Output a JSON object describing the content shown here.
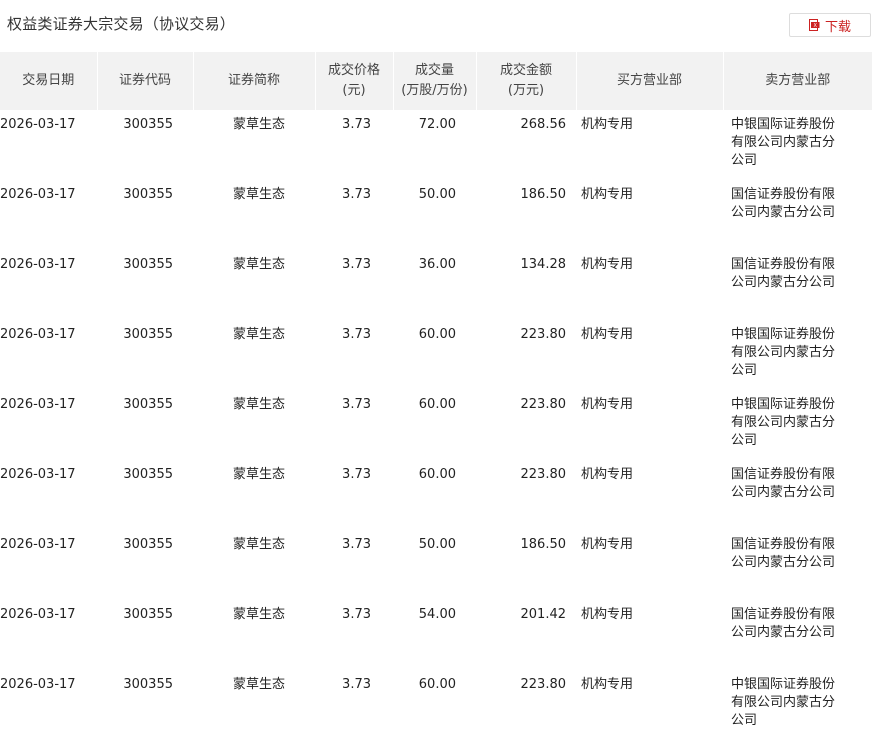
{
  "header": {
    "title": "权益类证券大宗交易（协议交易）",
    "download_label": "下载",
    "download_icon": "download-icon"
  },
  "colors": {
    "accent": "#cc2222",
    "header_bg": "#f2f2f2"
  },
  "table": {
    "columns": [
      [
        "交易日期"
      ],
      [
        "证券代码"
      ],
      [
        "证券简称"
      ],
      [
        "成交价格",
        "(元)"
      ],
      [
        "成交量",
        "(万股/万份)"
      ],
      [
        "成交金额",
        "(万元)"
      ],
      [
        "买方营业部"
      ],
      [
        "卖方营业部"
      ]
    ],
    "rows": [
      {
        "date": "2026-03-17",
        "code": "300355",
        "name": "蒙草生态",
        "price": "3.73",
        "volume": "72.00",
        "amount": "268.56",
        "buyer": "机构专用",
        "seller": "中银国际证券股份有限公司内蒙古分公司"
      },
      {
        "date": "2026-03-17",
        "code": "300355",
        "name": "蒙草生态",
        "price": "3.73",
        "volume": "50.00",
        "amount": "186.50",
        "buyer": "机构专用",
        "seller": "国信证券股份有限公司内蒙古分公司"
      },
      {
        "date": "2026-03-17",
        "code": "300355",
        "name": "蒙草生态",
        "price": "3.73",
        "volume": "36.00",
        "amount": "134.28",
        "buyer": "机构专用",
        "seller": "国信证券股份有限公司内蒙古分公司"
      },
      {
        "date": "2026-03-17",
        "code": "300355",
        "name": "蒙草生态",
        "price": "3.73",
        "volume": "60.00",
        "amount": "223.80",
        "buyer": "机构专用",
        "seller": "中银国际证券股份有限公司内蒙古分公司"
      },
      {
        "date": "2026-03-17",
        "code": "300355",
        "name": "蒙草生态",
        "price": "3.73",
        "volume": "60.00",
        "amount": "223.80",
        "buyer": "机构专用",
        "seller": "中银国际证券股份有限公司内蒙古分公司"
      },
      {
        "date": "2026-03-17",
        "code": "300355",
        "name": "蒙草生态",
        "price": "3.73",
        "volume": "60.00",
        "amount": "223.80",
        "buyer": "机构专用",
        "seller": "国信证券股份有限公司内蒙古分公司"
      },
      {
        "date": "2026-03-17",
        "code": "300355",
        "name": "蒙草生态",
        "price": "3.73",
        "volume": "50.00",
        "amount": "186.50",
        "buyer": "机构专用",
        "seller": "国信证券股份有限公司内蒙古分公司"
      },
      {
        "date": "2026-03-17",
        "code": "300355",
        "name": "蒙草生态",
        "price": "3.73",
        "volume": "54.00",
        "amount": "201.42",
        "buyer": "机构专用",
        "seller": "国信证券股份有限公司内蒙古分公司"
      },
      {
        "date": "2026-03-17",
        "code": "300355",
        "name": "蒙草生态",
        "price": "3.73",
        "volume": "60.00",
        "amount": "223.80",
        "buyer": "机构专用",
        "seller": "中银国际证券股份有限公司内蒙古分公司"
      }
    ]
  }
}
